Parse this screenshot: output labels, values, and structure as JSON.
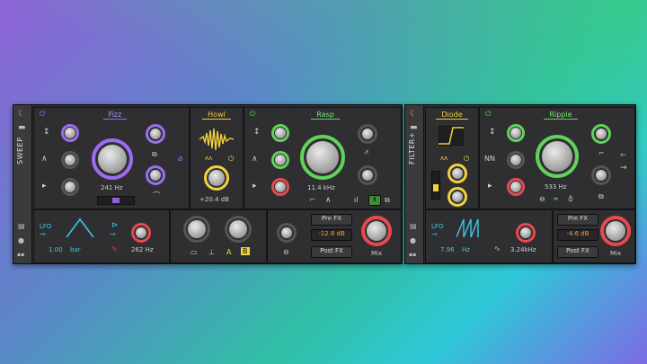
{
  "devices": [
    {
      "name": "SWEEP",
      "filter_a": {
        "title": "Fizz",
        "freq": "241 Hz"
      },
      "howl": {
        "title": "Howl",
        "gain": "+20.4 dB"
      },
      "filter_b": {
        "title": "Rasp",
        "freq": "11.4 kHz"
      },
      "lfo": {
        "label": "LFO",
        "rate": "1.00",
        "unit": "bar",
        "hz": "262 Hz"
      },
      "ab": {
        "a": "A",
        "b": "B"
      },
      "routing": {
        "pre": "Pre FX",
        "level": "-12.8 dB",
        "post": "Post FX",
        "mix": "Mix"
      }
    },
    {
      "name": "FILTER+",
      "diode": {
        "title": "Diode"
      },
      "ripple": {
        "title": "Ripple",
        "freq": "533 Hz"
      },
      "lfo": {
        "label": "LFO",
        "rate": "7.96",
        "unit": "Hz",
        "hz": "3.24kHz"
      },
      "routing": {
        "pre": "Pre FX",
        "level": "-4.6 dB",
        "post": "Post FX",
        "mix": "Mix"
      }
    }
  ],
  "colors": {
    "purple": "#9b6df0",
    "yellow": "#f2d23c",
    "green": "#5fd35a",
    "cyan": "#3fc6e8",
    "red": "#e8484f",
    "orange": "#ff9a2e"
  }
}
